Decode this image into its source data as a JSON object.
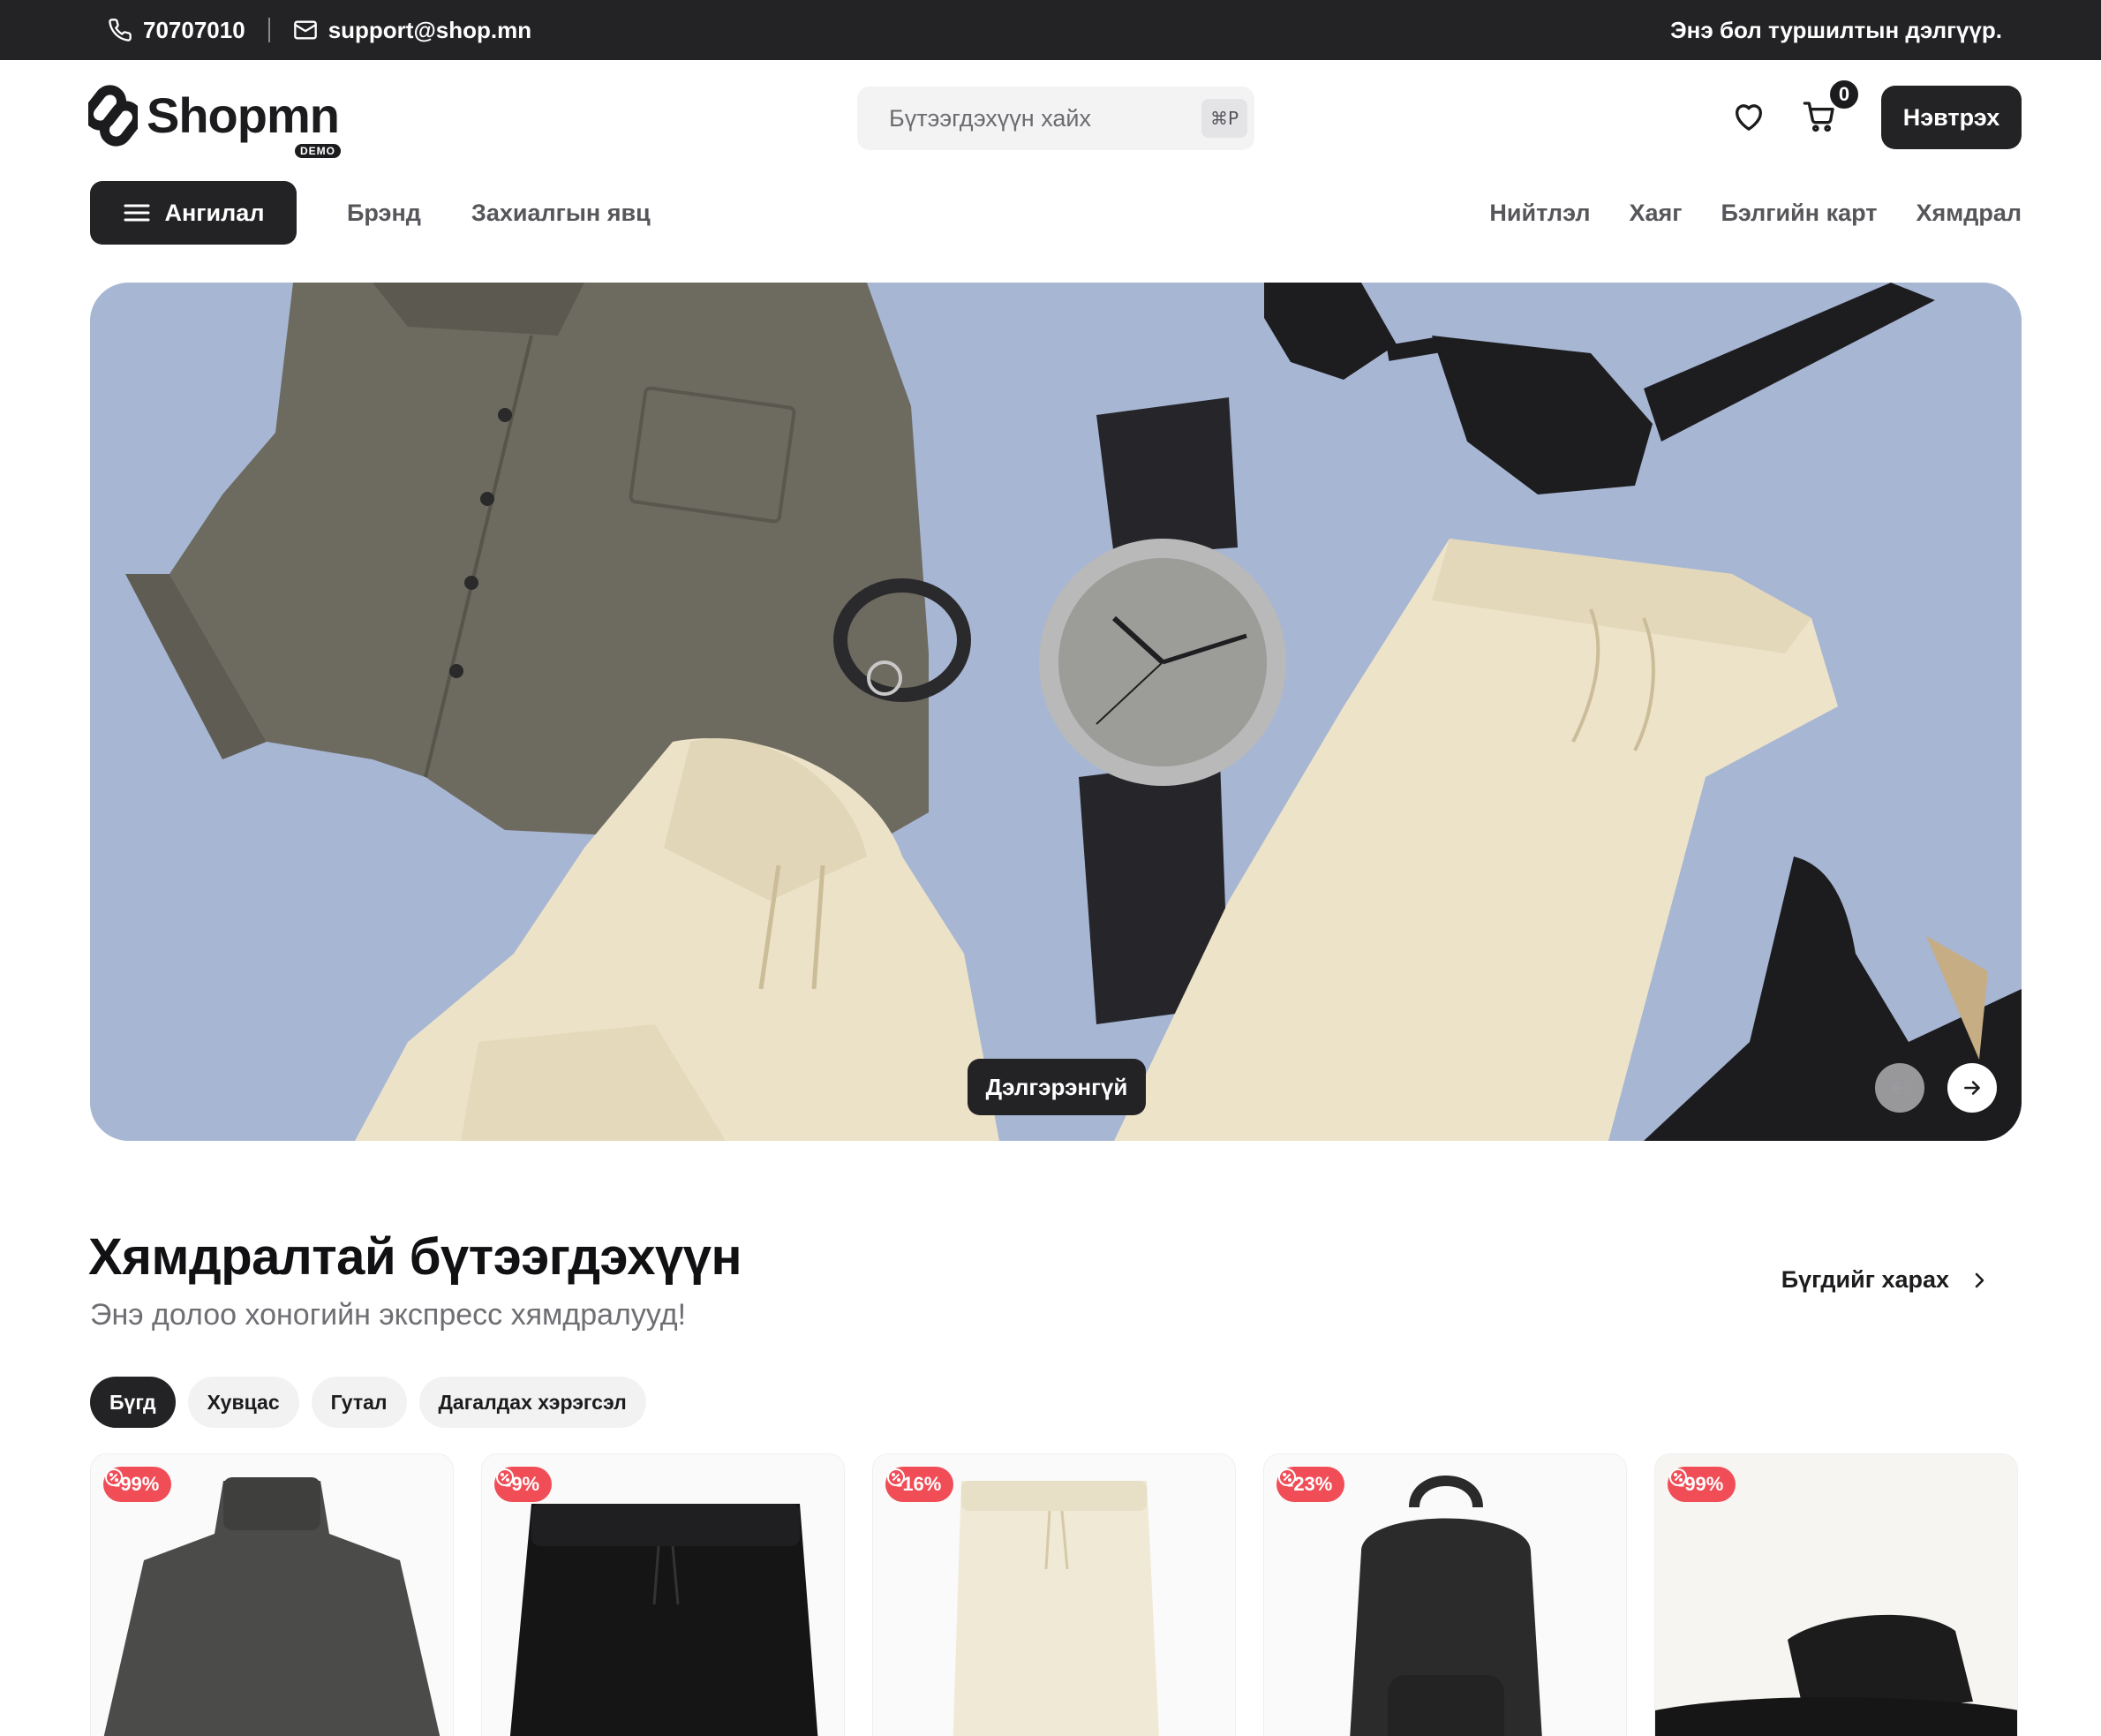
{
  "topbar": {
    "phone": "70707010",
    "email": "support@shop.mn",
    "notice": "Энэ бол туршилтын дэлгүүр."
  },
  "header": {
    "logo_text": "Shopmn",
    "logo_badge": "DEMO",
    "search_placeholder": "Бүтээгдэхүүн хайх",
    "search_shortcut": "⌘P",
    "cart_count": "0",
    "login_label": "Нэвтрэх"
  },
  "nav": {
    "category_label": "Ангилал",
    "left": [
      "Брэнд",
      "Захиалгын явц"
    ],
    "right": [
      "Нийтлэл",
      "Хаяг",
      "Бэлгийн карт",
      "Хямдрал"
    ]
  },
  "hero": {
    "cta_label": "Дэлгэрэнгүй"
  },
  "section": {
    "title": "Хямдралтай бүтээгдэхүүн",
    "subtitle": "Энэ долоо хоногийн экспресс хямдралууд!",
    "view_all": "Бүгдийг харах",
    "filters": [
      "Бүгд",
      "Хувцас",
      "Гутал",
      "Дагалдах хэрэгсэл"
    ],
    "active_filter": "Бүгд"
  },
  "products": [
    {
      "discount": "-99%"
    },
    {
      "discount": "-9%"
    },
    {
      "discount": "-16%"
    },
    {
      "discount": "-23%"
    },
    {
      "discount": "-99%"
    }
  ],
  "colors": {
    "dark": "#232325",
    "hero_bg": "#a7b6d3",
    "badge": "#f04d57"
  }
}
